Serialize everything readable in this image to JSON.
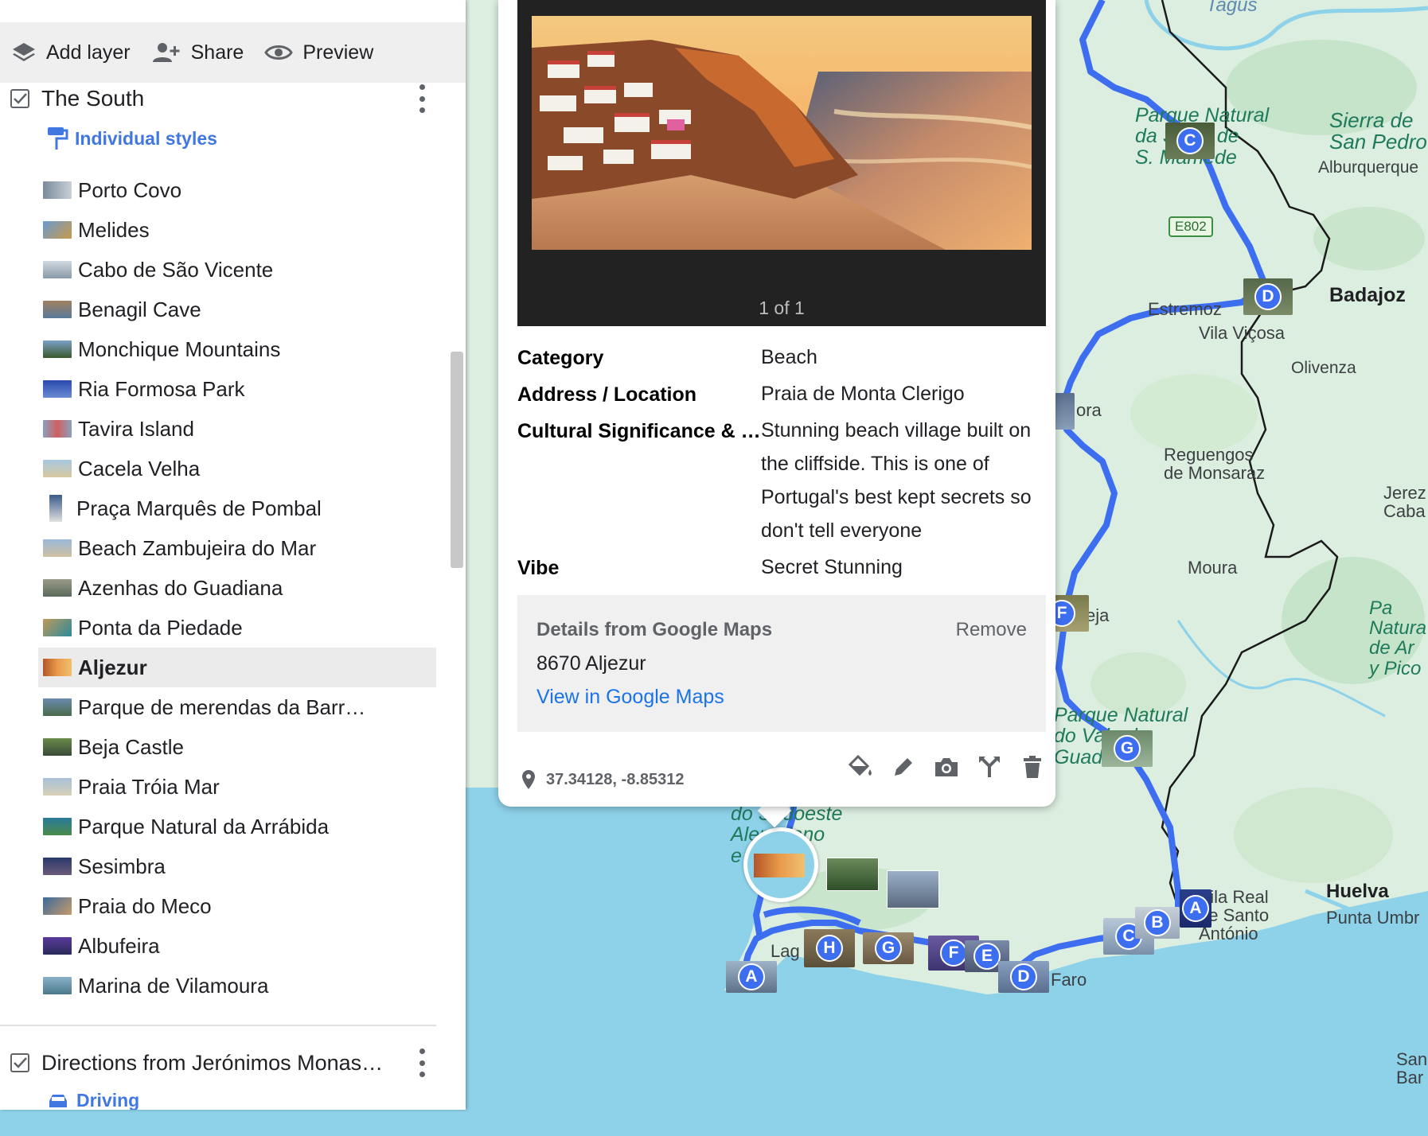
{
  "toolbar": {
    "add_layer": "Add layer",
    "share": "Share",
    "preview": "Preview"
  },
  "layers": [
    {
      "title": "The South",
      "style_link": "Individual styles",
      "items": [
        {
          "label": "Porto Covo"
        },
        {
          "label": "Melides"
        },
        {
          "label": "Cabo de São Vicente"
        },
        {
          "label": "Benagil Cave"
        },
        {
          "label": "Monchique Mountains"
        },
        {
          "label": "Ria Formosa Park"
        },
        {
          "label": "Tavira Island"
        },
        {
          "label": "Cacela Velha"
        },
        {
          "label": "Praça Marquês de Pombal"
        },
        {
          "label": "Beach Zambujeira do Mar"
        },
        {
          "label": "Azenhas do Guadiana"
        },
        {
          "label": "Ponta da Piedade"
        },
        {
          "label": "Aljezur",
          "selected": true
        },
        {
          "label": "Parque de merendas da Barr…"
        },
        {
          "label": "Beja Castle"
        },
        {
          "label": "Praia Tróia Mar"
        },
        {
          "label": "Parque Natural da Arrábida"
        },
        {
          "label": "Sesimbra"
        },
        {
          "label": "Praia do Meco"
        },
        {
          "label": "Albufeira"
        },
        {
          "label": "Marina de Vilamoura"
        }
      ]
    },
    {
      "title": "Directions from Jerónimos Monas…",
      "style_link": "Driving"
    }
  ],
  "card": {
    "photo_counter": "1 of 1",
    "fields": [
      {
        "key": "Category",
        "value": "Beach"
      },
      {
        "key": "Address / Location",
        "value": "Praia de Monta Clerigo"
      },
      {
        "key": "Cultural Significance & …",
        "value": "Stunning beach village built on the cliffside. This is one of Portugal's best kept secrets so don't tell everyone"
      },
      {
        "key": "Vibe",
        "value": "Secret Stunning"
      }
    ],
    "google_maps": {
      "title": "Details from Google Maps",
      "remove": "Remove",
      "address": "8670 Aljezur",
      "link": "View in Google Maps"
    },
    "coordinates": "37.34128, -8.85312"
  },
  "map": {
    "labels": {
      "tagus": "Tagus",
      "parque_natural_sao_mamede": [
        "Parque Natural",
        "da Serra de",
        "S. Mamede"
      ],
      "sierra_san_pedro": [
        "Sierra de",
        "San Pedro"
      ],
      "alburquerque": "Alburquerque",
      "e802": "E802",
      "estremoz": "Estremoz",
      "badajoz": "Badajoz",
      "vila_vicosa": "Vila Viçosa",
      "olivenza": "Olivenza",
      "evora": "ora",
      "reguengos": [
        "Reguengos",
        "de Monsaraz"
      ],
      "jerez": [
        "Jerez",
        "Caba"
      ],
      "moura": "Moura",
      "beja": "eja",
      "parque_natural_pa": [
        "Pa",
        "Natura",
        "de Ar",
        "y Pico"
      ],
      "parque_natural_guadiana": [
        "Parque Natural",
        "do Vale do",
        "Guadiana"
      ],
      "sudoeste": [
        "do Sudoeste",
        "Alentejano",
        "e Costa"
      ],
      "vila_real": [
        "Vila Real",
        "de Santo",
        "António"
      ],
      "huelva": "Huelva",
      "punta_umbria": "Punta Umbr",
      "faro": "Faro",
      "lagos": "Lag",
      "san_bar": [
        "San",
        "Bar"
      ]
    },
    "route_markers_north": [
      "C",
      "D",
      "F",
      "G"
    ],
    "route_markers_south": [
      "A",
      "H",
      "G",
      "F",
      "E",
      "D",
      "C",
      "B",
      "A"
    ],
    "colors": {
      "route": "#3d6ef0",
      "land": "#dceee0",
      "sea": "#8ed2ea",
      "border": "#1a1a1a"
    }
  }
}
